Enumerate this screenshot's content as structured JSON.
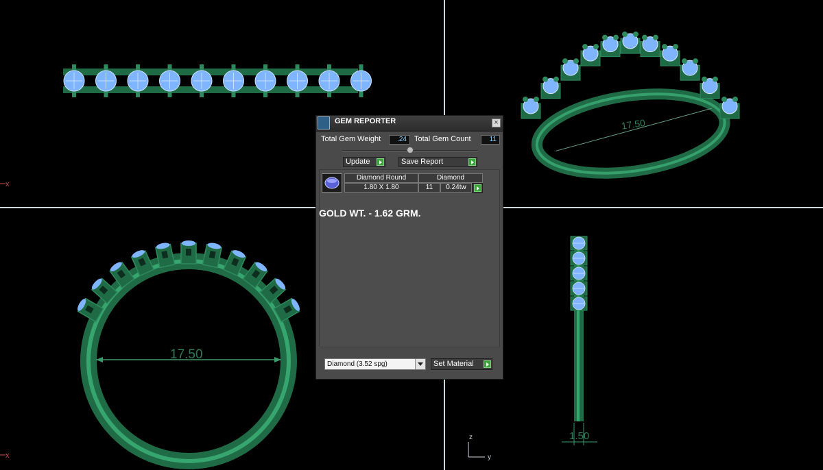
{
  "viewports": {
    "top_left": {
      "name": "top-view"
    },
    "top_right": {
      "name": "perspective-view",
      "dimension": "17.50"
    },
    "bottom_left": {
      "name": "front-view",
      "dimension": "17.50",
      "axis_label": "x"
    },
    "bottom_right": {
      "name": "side-view",
      "dimension": "1.50",
      "axis_z": "z",
      "axis_y": "y"
    },
    "top_left_axis": "x"
  },
  "gem_reporter": {
    "title": "GEM REPORTER",
    "total_gem_weight_label": "Total Gem Weight",
    "total_gem_weight": ".24",
    "total_gem_count_label": "Total Gem Count",
    "total_gem_count": "11",
    "update_label": "Update",
    "save_report_label": "Save Report",
    "gem_row": {
      "shape": "Diamond Round",
      "size": "1.80 X 1.80",
      "material": "Diamond",
      "count": "11",
      "weight": "0.24tw"
    },
    "gold_weight_text": "GOLD WT. - 1.62 GRM.",
    "material_select": "Diamond     (3.52 spg)",
    "set_material_label": "Set Material"
  },
  "colors": {
    "metal": "#2e8a5e",
    "gem": "#7fb4ff",
    "background": "#000000"
  }
}
